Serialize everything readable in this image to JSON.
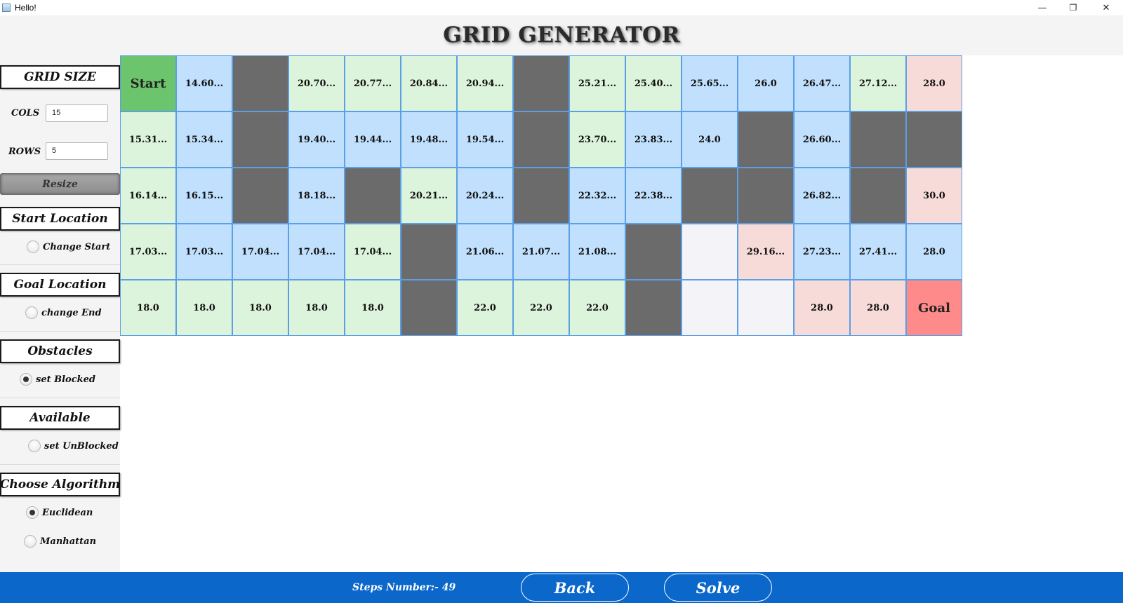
{
  "window": {
    "title": "Hello!",
    "minimize": "—",
    "maximize": "❐",
    "close": "✕"
  },
  "header": {
    "title": "GRID GENERATOR"
  },
  "sidebar": {
    "grid_size": {
      "heading": "GRID SIZE",
      "cols_label": "COLS",
      "cols_value": "15",
      "rows_label": "ROWS",
      "rows_value": "5",
      "resize_label": "Resize"
    },
    "start": {
      "heading": "Start Location",
      "option": "Change Start",
      "selected": false
    },
    "goal": {
      "heading": "Goal Location",
      "option": "change End",
      "selected": false
    },
    "obstacles": {
      "heading": "Obstacles",
      "option": "set Blocked",
      "selected": true
    },
    "available": {
      "heading": "Available",
      "option": "set UnBlocked",
      "selected": false
    },
    "algorithm": {
      "heading": "Choose Algorithm",
      "options": [
        {
          "label": "Euclidean",
          "selected": true
        },
        {
          "label": "Manhattan",
          "selected": false
        }
      ]
    }
  },
  "colors": {
    "start": "#6cc46c",
    "goal": "#ff8a8a",
    "green": "#dcf3dc",
    "blue": "#c0e0fd",
    "pink": "#f7dbd9",
    "blocked": "#6b6b6b",
    "empty": "#f4f3f7",
    "footer": "#0b67c9"
  },
  "grid": {
    "cols": 15,
    "rows": 5,
    "cells": [
      [
        {
          "t": "start",
          "v": "Start"
        },
        {
          "t": "blue",
          "v": "14.60..."
        },
        {
          "t": "blocked",
          "v": ""
        },
        {
          "t": "green",
          "v": "20.70..."
        },
        {
          "t": "green",
          "v": "20.77..."
        },
        {
          "t": "green",
          "v": "20.84..."
        },
        {
          "t": "green",
          "v": "20.94..."
        },
        {
          "t": "blocked",
          "v": ""
        },
        {
          "t": "green",
          "v": "25.21..."
        },
        {
          "t": "green",
          "v": "25.40..."
        },
        {
          "t": "blue",
          "v": "25.65..."
        },
        {
          "t": "blue",
          "v": "26.0"
        },
        {
          "t": "blue",
          "v": "26.47..."
        },
        {
          "t": "green",
          "v": "27.12..."
        },
        {
          "t": "pink",
          "v": "28.0"
        }
      ],
      [
        {
          "t": "green",
          "v": "15.31..."
        },
        {
          "t": "blue",
          "v": "15.34..."
        },
        {
          "t": "blocked",
          "v": ""
        },
        {
          "t": "blue",
          "v": "19.40..."
        },
        {
          "t": "blue",
          "v": "19.44..."
        },
        {
          "t": "blue",
          "v": "19.48..."
        },
        {
          "t": "blue",
          "v": "19.54..."
        },
        {
          "t": "blocked",
          "v": ""
        },
        {
          "t": "green",
          "v": "23.70..."
        },
        {
          "t": "blue",
          "v": "23.83..."
        },
        {
          "t": "blue",
          "v": "24.0"
        },
        {
          "t": "blocked",
          "v": ""
        },
        {
          "t": "blue",
          "v": "26.60..."
        },
        {
          "t": "blocked",
          "v": ""
        },
        {
          "t": "blocked",
          "v": ""
        }
      ],
      [
        {
          "t": "green",
          "v": "16.14..."
        },
        {
          "t": "blue",
          "v": "16.15..."
        },
        {
          "t": "blocked",
          "v": ""
        },
        {
          "t": "blue",
          "v": "18.18..."
        },
        {
          "t": "blocked",
          "v": ""
        },
        {
          "t": "green",
          "v": "20.21..."
        },
        {
          "t": "blue",
          "v": "20.24..."
        },
        {
          "t": "blocked",
          "v": ""
        },
        {
          "t": "blue",
          "v": "22.32..."
        },
        {
          "t": "blue",
          "v": "22.38..."
        },
        {
          "t": "blocked",
          "v": ""
        },
        {
          "t": "blocked",
          "v": ""
        },
        {
          "t": "blue",
          "v": "26.82..."
        },
        {
          "t": "blocked",
          "v": ""
        },
        {
          "t": "pink",
          "v": "30.0"
        }
      ],
      [
        {
          "t": "green",
          "v": "17.03..."
        },
        {
          "t": "blue",
          "v": "17.03..."
        },
        {
          "t": "blue",
          "v": "17.04..."
        },
        {
          "t": "blue",
          "v": "17.04..."
        },
        {
          "t": "green",
          "v": "17.04..."
        },
        {
          "t": "blocked",
          "v": ""
        },
        {
          "t": "blue",
          "v": "21.06..."
        },
        {
          "t": "blue",
          "v": "21.07..."
        },
        {
          "t": "blue",
          "v": "21.08..."
        },
        {
          "t": "blocked",
          "v": ""
        },
        {
          "t": "empty",
          "v": ""
        },
        {
          "t": "pink",
          "v": "29.16..."
        },
        {
          "t": "blue",
          "v": "27.23..."
        },
        {
          "t": "blue",
          "v": "27.41..."
        },
        {
          "t": "blue",
          "v": "28.0"
        }
      ],
      [
        {
          "t": "green",
          "v": "18.0"
        },
        {
          "t": "green",
          "v": "18.0"
        },
        {
          "t": "green",
          "v": "18.0"
        },
        {
          "t": "green",
          "v": "18.0"
        },
        {
          "t": "green",
          "v": "18.0"
        },
        {
          "t": "blocked",
          "v": ""
        },
        {
          "t": "green",
          "v": "22.0"
        },
        {
          "t": "green",
          "v": "22.0"
        },
        {
          "t": "green",
          "v": "22.0"
        },
        {
          "t": "blocked",
          "v": ""
        },
        {
          "t": "empty",
          "v": ""
        },
        {
          "t": "empty",
          "v": ""
        },
        {
          "t": "pink",
          "v": "28.0"
        },
        {
          "t": "pink",
          "v": "28.0"
        },
        {
          "t": "goal",
          "v": "Goal"
        }
      ]
    ]
  },
  "footer": {
    "steps_text": "Steps Number:- 49",
    "back_label": "Back",
    "solve_label": "Solve"
  }
}
